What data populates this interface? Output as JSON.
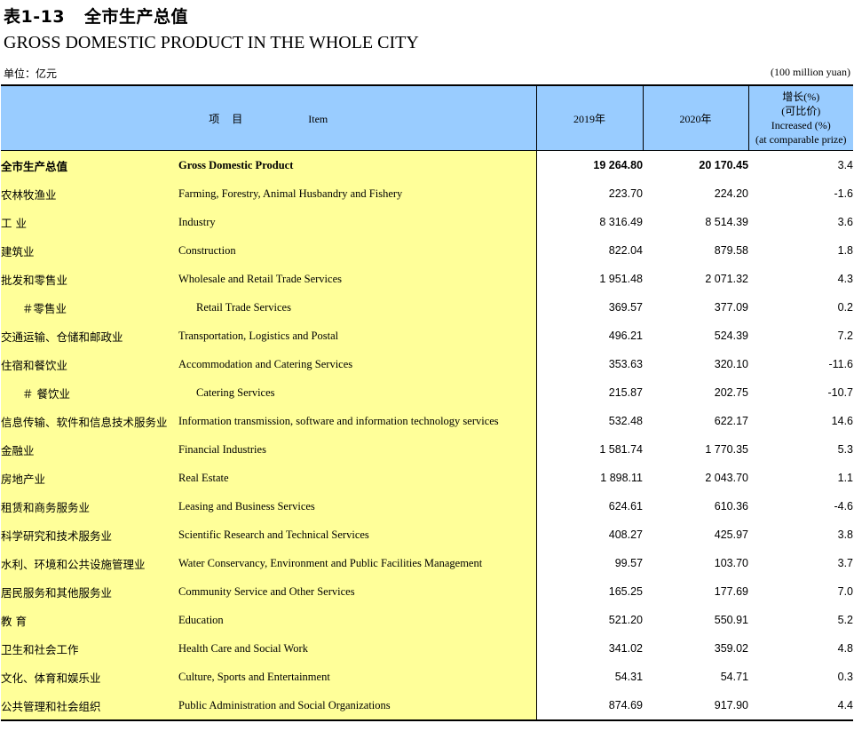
{
  "title": {
    "table_no": "表1-13",
    "cn": "全市生产总值",
    "en": "GROSS DOMESTIC PRODUCT IN THE WHOLE CITY"
  },
  "unit": {
    "cn": "单位：亿元",
    "en": "(100 million yuan)"
  },
  "header": {
    "item_cn": "项目",
    "item_en": "Item",
    "y2019": "2019年",
    "y2020": "2020年",
    "growth_lines": [
      "增长(%)",
      "(可比价)",
      "Increased (%)",
      "(at comparable prize)"
    ]
  },
  "rows": [
    {
      "cn": "全市生产总值",
      "en": "Gross Domestic Product",
      "v2019": "19 264.80",
      "v2020": "20 170.45",
      "growth": "3.4"
    },
    {
      "cn": "农林牧渔业",
      "en": "Farming, Forestry, Animal Husbandry and Fishery",
      "v2019": "223.70",
      "v2020": "224.20",
      "growth": "-1.6"
    },
    {
      "cn": "工 业",
      "en": "Industry",
      "v2019": "8 316.49",
      "v2020": "8 514.39",
      "growth": "3.6"
    },
    {
      "cn": "建筑业",
      "en": "Construction",
      "v2019": "822.04",
      "v2020": "879.58",
      "growth": "1.8"
    },
    {
      "cn": "批发和零售业",
      "en": "Wholesale and Retail Trade Services",
      "v2019": "1 951.48",
      "v2020": "2 071.32",
      "growth": "4.3"
    },
    {
      "cn": "＃零售业",
      "en": "Retail Trade Services",
      "v2019": "369.57",
      "v2020": "377.09",
      "growth": "0.2"
    },
    {
      "cn": "交通运输、仓储和邮政业",
      "en": "Transportation, Logistics and Postal",
      "v2019": "496.21",
      "v2020": "524.39",
      "growth": "7.2"
    },
    {
      "cn": "住宿和餐饮业",
      "en": "Accommodation  and Catering Services",
      "v2019": "353.63",
      "v2020": "320.10",
      "growth": "-11.6"
    },
    {
      "cn": "＃ 餐饮业",
      "en": "Catering Services",
      "v2019": "215.87",
      "v2020": "202.75",
      "growth": "-10.7"
    },
    {
      "cn": "信息传输、软件和信息技术服务业",
      "en": "Information transmission, software and information technology services",
      "v2019": "532.48",
      "v2020": "622.17",
      "growth": "14.6"
    },
    {
      "cn": "金融业",
      "en": "Financial Industries",
      "v2019": "1 581.74",
      "v2020": "1 770.35",
      "growth": "5.3"
    },
    {
      "cn": "房地产业",
      "en": "Real Estate",
      "v2019": "1 898.11",
      "v2020": "2 043.70",
      "growth": "1.1"
    },
    {
      "cn": "租赁和商务服务业",
      "en": "Leasing and Business Services",
      "v2019": "624.61",
      "v2020": "610.36",
      "growth": "-4.6"
    },
    {
      "cn": "科学研究和技术服务业",
      "en": "Scientific Research and Technical Services",
      "v2019": "408.27",
      "v2020": "425.97",
      "growth": "3.8"
    },
    {
      "cn": "水利、环境和公共设施管理业",
      "en": "Water Conservancy, Environment and Public Facilities Management",
      "v2019": "99.57",
      "v2020": "103.70",
      "growth": "3.7"
    },
    {
      "cn": "居民服务和其他服务业",
      "en": "Community Service and Other Services",
      "v2019": "165.25",
      "v2020": "177.69",
      "growth": "7.0"
    },
    {
      "cn": "教 育",
      "en": "Education",
      "v2019": "521.20",
      "v2020": "550.91",
      "growth": "5.2"
    },
    {
      "cn": "卫生和社会工作",
      "en": "Health Care and Social Work",
      "v2019": "341.02",
      "v2020": "359.02",
      "growth": "4.8"
    },
    {
      "cn": "文化、体育和娱乐业",
      "en": "Culture, Sports and Entertainment",
      "v2019": "54.31",
      "v2020": "54.71",
      "growth": "0.3"
    },
    {
      "cn": "公共管理和社会组织",
      "en": "Public Administration and Social Organizations",
      "v2019": "874.69",
      "v2020": "917.90",
      "growth": "4.4"
    }
  ],
  "colors": {
    "header_bg": "#99ccff",
    "label_bg": "#ffff99"
  }
}
